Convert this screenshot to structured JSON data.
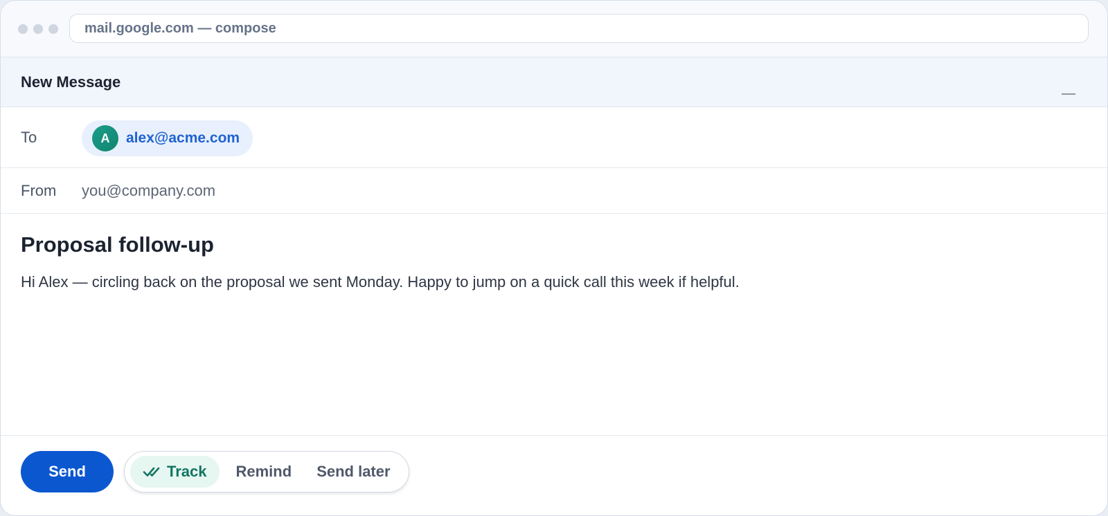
{
  "browser": {
    "address": "mail.google.com — compose"
  },
  "compose": {
    "title": "New Message",
    "minimize_icon": "minimize-icon"
  },
  "to": {
    "label": "To",
    "recipient": {
      "initial": "A",
      "email": "alex@acme.com"
    }
  },
  "from": {
    "label": "From",
    "value": "you@company.com"
  },
  "message": {
    "subject": "Proposal follow-up",
    "body": "Hi Alex — circling back on the proposal we sent Monday. Happy to jump on a quick call this week if helpful."
  },
  "footer": {
    "send_label": "Send",
    "tools": {
      "track_label": "Track",
      "track_icon": "double-check-icon",
      "remind_label": "Remind",
      "send_later_label": "Send later"
    }
  },
  "colors": {
    "send_button": "#0b57d0",
    "chip_background": "#e8f0fd",
    "chip_text": "#1f63cf",
    "avatar": "#1a9e8a",
    "track_active_background": "#e6f6f0",
    "track_active_text": "#137562"
  }
}
